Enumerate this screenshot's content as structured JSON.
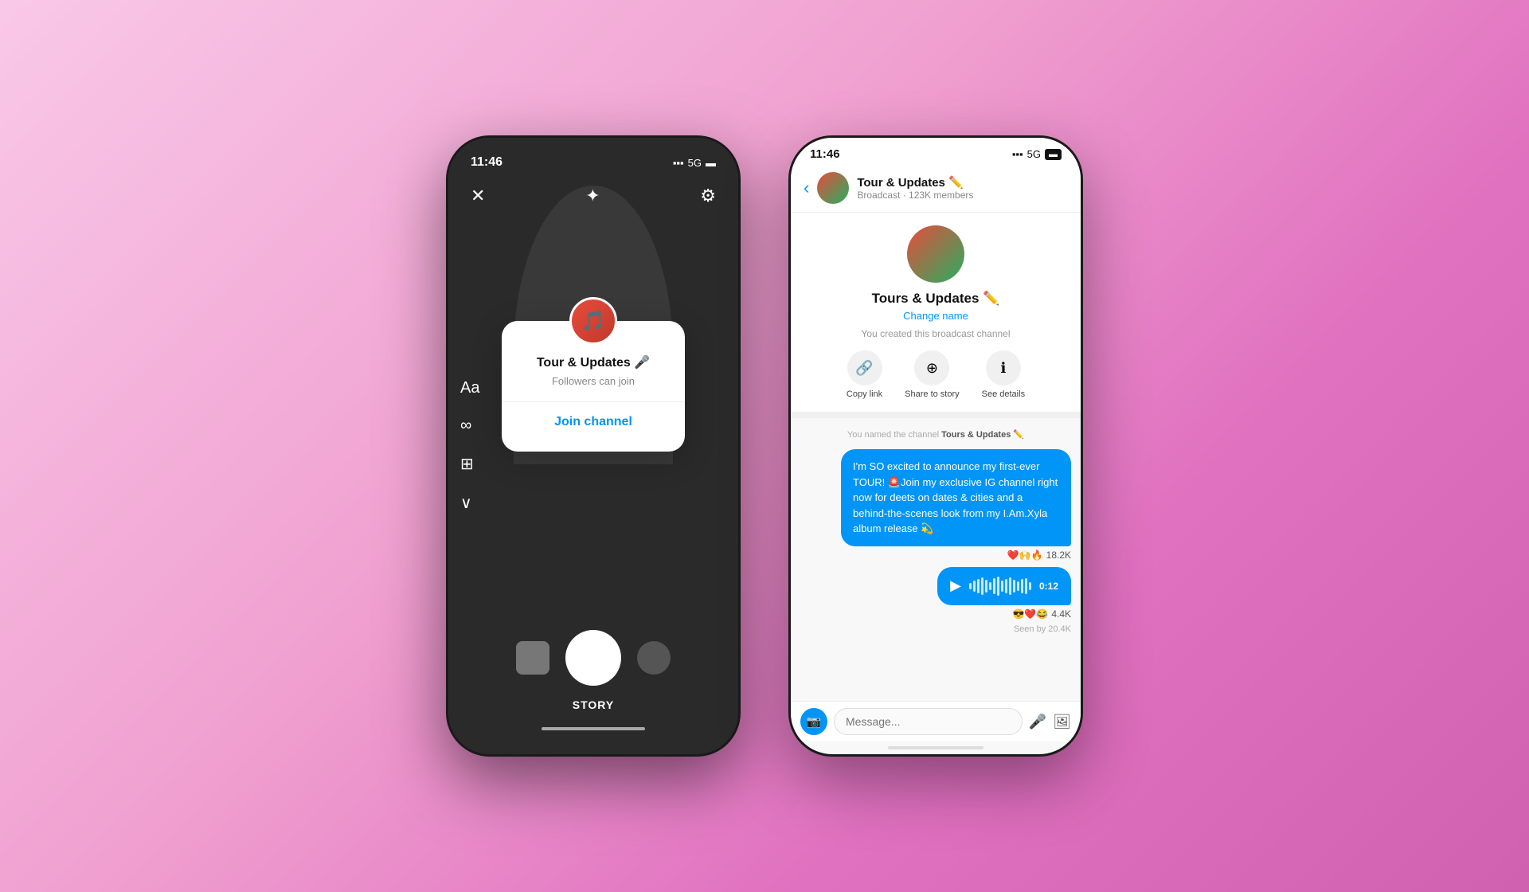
{
  "leftPhone": {
    "statusBar": {
      "time": "11:46",
      "signal": "📶",
      "network": "5G",
      "battery": "🔋"
    },
    "popup": {
      "title": "Tour & Updates 🎤",
      "subtitle": "Followers can join",
      "joinLabel": "Join channel"
    },
    "bottomLabel": "STORY"
  },
  "rightPhone": {
    "statusBar": {
      "time": "11:46",
      "network": "5G"
    },
    "header": {
      "channelName": "Tour & Updates ✏️",
      "subtext": "Broadcast · 123K members"
    },
    "channelInfo": {
      "name": "Tours & Updates ✏️",
      "changeName": "Change name",
      "createdText": "You created this broadcast channel"
    },
    "actions": [
      {
        "label": "Copy link",
        "icon": "🔗"
      },
      {
        "label": "Share to story",
        "icon": "➕"
      },
      {
        "label": "See details",
        "icon": "ℹ️"
      }
    ],
    "systemMsg": "You named the channel Tours & Updates ✏️",
    "messages": [
      {
        "text": "I'm SO excited to announce my first-ever TOUR! 🚨Join my exclusive IG channel right now for deets on dates & cities and a behind-the-scenes look from my I.Am.Xyla album release 💫",
        "reactions": "❤️🙌🔥",
        "reactionCount": "18.2K"
      }
    ],
    "audioMsg": {
      "duration": "0:12",
      "reactions": "😎❤️😂",
      "reactionCount": "4.4K"
    },
    "seenBy": "Seen by 20.4K",
    "inputPlaceholder": "Message..."
  }
}
